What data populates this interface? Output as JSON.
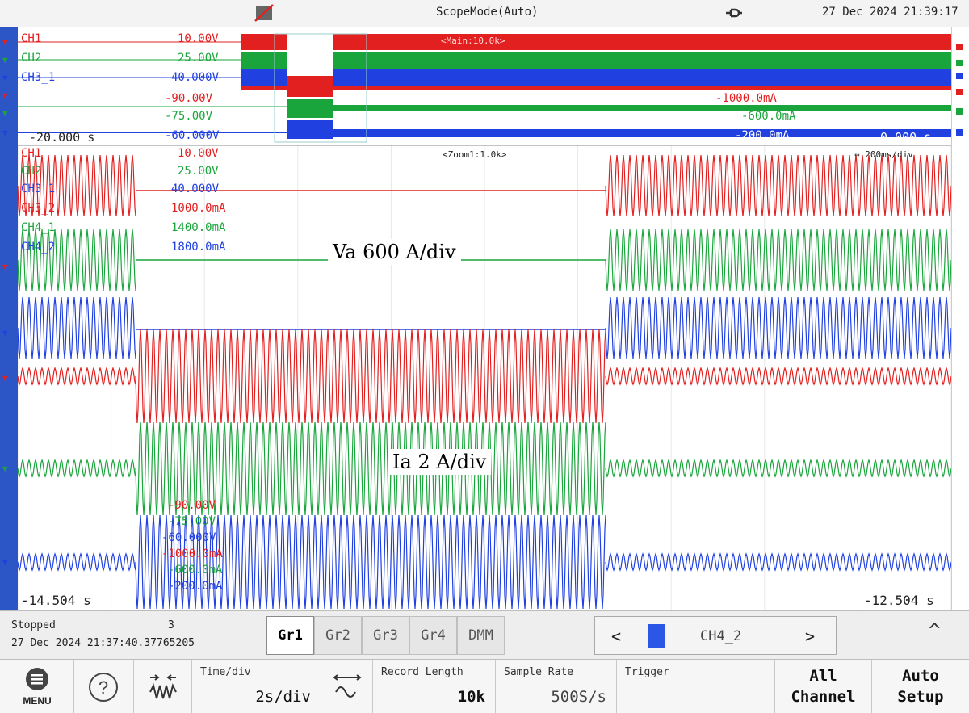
{
  "topbar": {
    "mode": "ScopeMode(Auto)",
    "datetime": "27 Dec 2024 21:39:17"
  },
  "overview": {
    "channels": [
      {
        "name": "CH1",
        "top": "10.00V",
        "bottom": "-90.00V",
        "color": "#e32020"
      },
      {
        "name": "CH2",
        "top": "25.00V",
        "bottom": "-75.00V",
        "color": "#1aa53c"
      },
      {
        "name": "CH3_1",
        "top": "40.000V",
        "bottom": "-60.000V",
        "color": "#2040e0"
      }
    ],
    "right_values": [
      "-1000.0mA",
      "-600.0mA",
      "-200.0mA"
    ],
    "main_label": "<Main:10.0k>",
    "time_left": "-20.000 s",
    "time_right": "0.000 s"
  },
  "zoom": {
    "label": "<Zoom1:1.0k>",
    "timebase": "200ms/div",
    "channels": [
      {
        "name": "CH1",
        "value": "10.00V",
        "color": "#e32020"
      },
      {
        "name": "CH2",
        "value": "25.00V",
        "color": "#1aa53c"
      },
      {
        "name": "CH3_1",
        "value": "40.000V",
        "color": "#2040e0"
      },
      {
        "name": "CH3_2",
        "value": "1000.0mA",
        "color": "#e32020"
      },
      {
        "name": "CH4_1",
        "value": "1400.0mA",
        "color": "#1aa53c"
      },
      {
        "name": "CH4_2",
        "value": "1800.0mA",
        "color": "#2040e0"
      }
    ],
    "bottom_values": [
      "-90.00V",
      "-75.00V",
      "-60.000V",
      "-1000.0mA",
      "-600.0mA",
      "-200.0mA"
    ],
    "time_left": "-14.504 s",
    "time_right": "-12.504 s"
  },
  "annotations": {
    "voltage": "Va 600 A/div",
    "current": "Ia 2 A/div"
  },
  "status": {
    "state": "Stopped",
    "count": "3",
    "timestamp": "27 Dec 2024 21:37:40.37765205",
    "tabs": [
      "Gr1",
      "Gr2",
      "Gr3",
      "Gr4",
      "DMM"
    ],
    "active_tab": "Gr1",
    "channel_selector": "CH4_2",
    "prev": "<",
    "next": ">",
    "expand": "^"
  },
  "softkeys": {
    "menu": "MENU",
    "time_div_caption": "Time/div",
    "time_div_value": "2s/div",
    "record_length_caption": "Record Length",
    "record_length_value": "10k",
    "sample_rate_caption": "Sample Rate",
    "sample_rate_value": "500S/s",
    "trigger_caption": "Trigger",
    "all_channel_1": "All",
    "all_channel_2": "Channel",
    "auto_setup_1": "Auto",
    "auto_setup_2": "Setup"
  },
  "colors": {
    "red": "#e32020",
    "green": "#1aa53c",
    "blue": "#2040e0",
    "marker_strip": "#2c56c5"
  }
}
